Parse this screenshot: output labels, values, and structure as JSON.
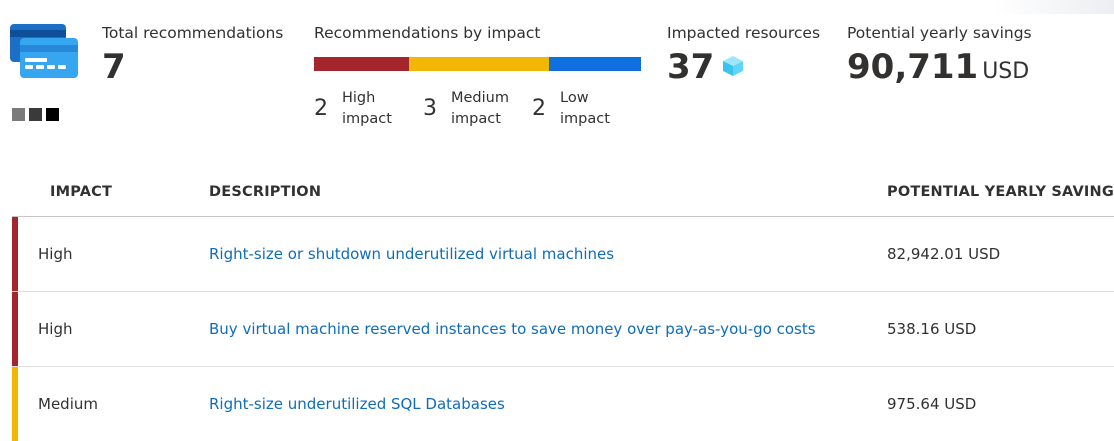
{
  "colors": {
    "high": "#a4262c",
    "medium": "#f2b705",
    "low": "#0f6fde",
    "link": "#0f6cbd",
    "text": "#323130"
  },
  "summary": {
    "total_label": "Total recommendations",
    "total_value": "7",
    "by_impact_label": "Recommendations by impact",
    "impact_bar_fractions": {
      "high": 0.29,
      "medium": 0.43,
      "low": 0.28
    },
    "impacts": [
      {
        "count": "2",
        "label": "High impact"
      },
      {
        "count": "3",
        "label": "Medium impact"
      },
      {
        "count": "2",
        "label": "Low impact"
      }
    ],
    "resources_label": "Impacted resources",
    "resources_value": "37",
    "savings_label": "Potential yearly savings",
    "savings_value": "90,711",
    "savings_unit": "USD"
  },
  "table": {
    "headers": {
      "impact": "IMPACT",
      "description": "DESCRIPTION",
      "savings": "POTENTIAL YEARLY SAVINGS*"
    },
    "rows": [
      {
        "impact": "High",
        "description": "Right-size or shutdown underutilized virtual machines",
        "savings": "82,942.01 USD"
      },
      {
        "impact": "High",
        "description": "Buy virtual machine reserved instances to save money over pay-as-you-go costs",
        "savings": "538.16 USD"
      },
      {
        "impact": "Medium",
        "description": "Right-size underutilized SQL Databases",
        "savings": "975.64 USD"
      }
    ]
  },
  "icons": {
    "cost": "credit-card-stack-icon",
    "resource": "cube-icon",
    "squares": "color-squares-icon"
  }
}
